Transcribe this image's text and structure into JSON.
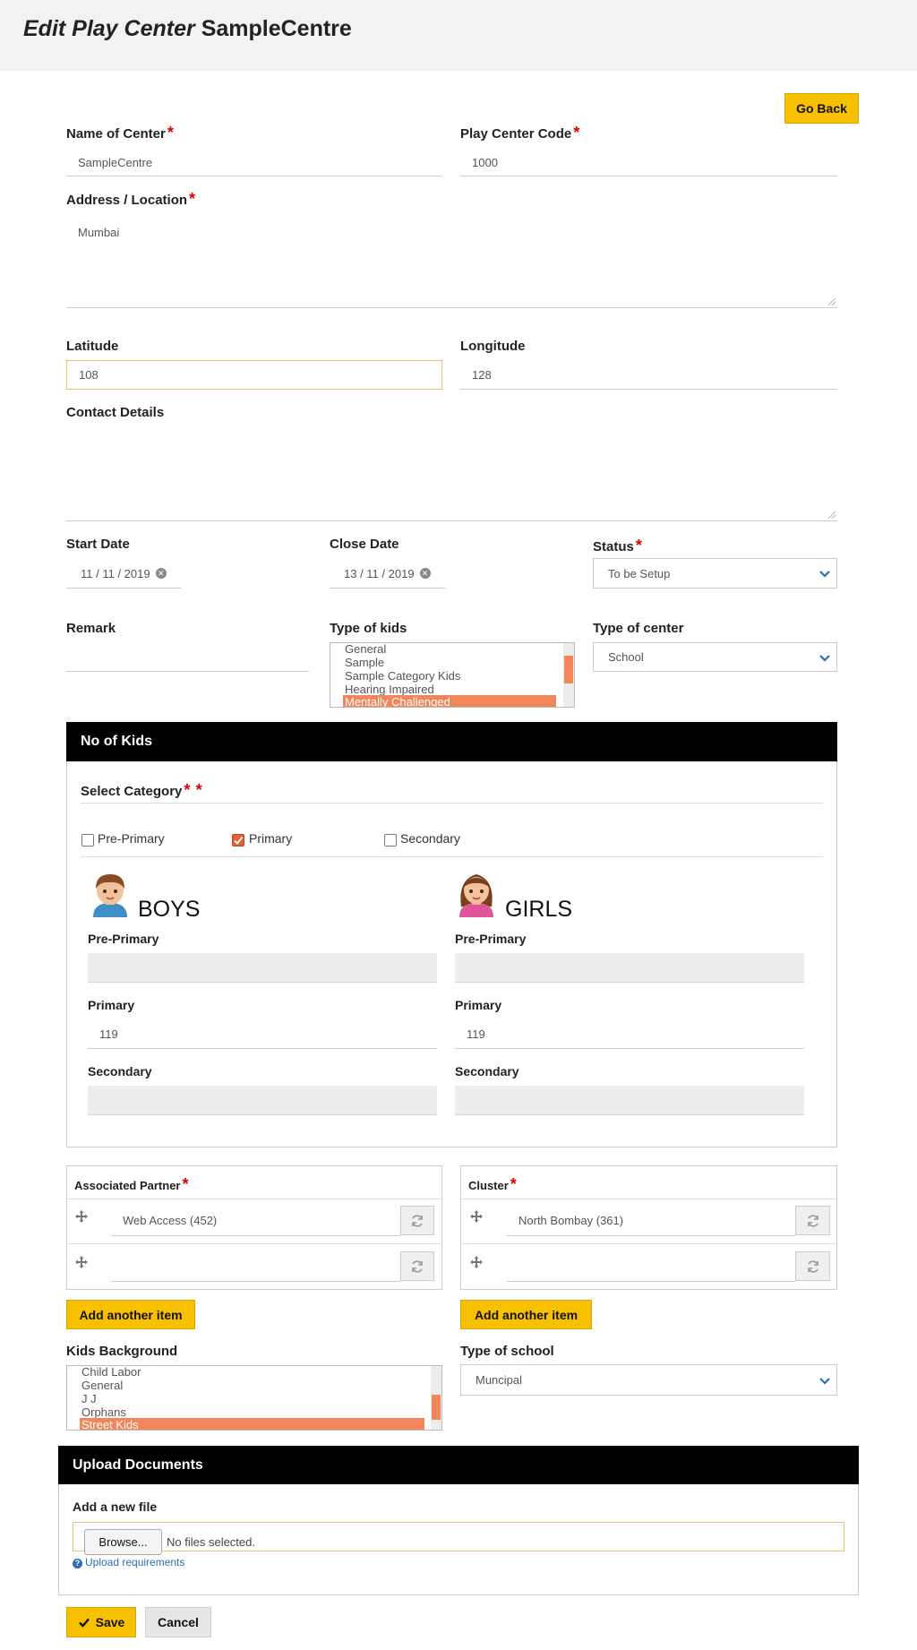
{
  "header": {
    "title_italic": "Edit Play Center",
    "title_name": "SampleCentre"
  },
  "go_back_label": "Go Back",
  "required_mark": "*",
  "form": {
    "name_label": "Name of Center",
    "name_value": "SampleCentre",
    "code_label": "Play Center Code",
    "code_value": "1000",
    "address_label": "Address / Location",
    "address_value": "Mumbai",
    "latitude_label": "Latitude",
    "latitude_value": "108",
    "longitude_label": "Longitude",
    "longitude_value": "128",
    "contact_label": "Contact Details",
    "contact_value": "",
    "start_date_label": "Start Date",
    "start_date_value": "11 / 11 / 2019",
    "close_date_label": "Close Date",
    "close_date_value": "13 / 11 / 2019",
    "status_label": "Status",
    "status_value": "To be Setup",
    "remark_label": "Remark",
    "remark_value": "",
    "kids_type_label": "Type of kids",
    "kids_type_options": [
      "General",
      "Sample",
      "Sample Category Kids",
      "Hearing Impaired",
      "Mentally Challenged"
    ],
    "kids_type_selected": "Mentally Challenged",
    "center_type_label": "Type of center",
    "center_type_value": "School"
  },
  "no_of_kids": {
    "title": "No of Kids",
    "select_category_label": "Select Category",
    "extra_required_mark": "*",
    "categories": [
      {
        "label": "Pre-Primary",
        "checked": false
      },
      {
        "label": "Primary",
        "checked": true
      },
      {
        "label": "Secondary",
        "checked": false
      }
    ],
    "boys": {
      "title": "BOYS",
      "pre_primary_label": "Pre-Primary",
      "pre_primary_value": "",
      "primary_label": "Primary",
      "primary_value": "119",
      "secondary_label": "Secondary",
      "secondary_value": ""
    },
    "girls": {
      "title": "GIRLS",
      "pre_primary_label": "Pre-Primary",
      "pre_primary_value": "",
      "primary_label": "Primary",
      "primary_value": "119",
      "secondary_label": "Secondary",
      "secondary_value": ""
    }
  },
  "partner": {
    "label": "Associated Partner",
    "rows": [
      "Web Access (452)",
      ""
    ],
    "add_label": "Add another item"
  },
  "cluster": {
    "label": "Cluster",
    "rows": [
      "North Bombay (361)",
      ""
    ],
    "add_label": "Add another item"
  },
  "kids_background": {
    "label": "Kids Background",
    "options": [
      "Child Labor",
      "General",
      "J J",
      "Orphans",
      "Street Kids"
    ],
    "selected": "Street Kids"
  },
  "school_type": {
    "label": "Type of school",
    "value": "Muncipal"
  },
  "upload": {
    "title": "Upload Documents",
    "add_file_label": "Add a new file",
    "browse_label": "Browse...",
    "no_file_text": "No files selected.",
    "requirements_link": "Upload requirements"
  },
  "actions": {
    "save_label": "Save",
    "cancel_label": "Cancel"
  },
  "colors": {
    "accent_yellow": "#f7c100",
    "selection_orange": "#f0865a",
    "required_red": "#e00000",
    "link_blue": "#2d6db5",
    "panel_black": "#000000"
  }
}
